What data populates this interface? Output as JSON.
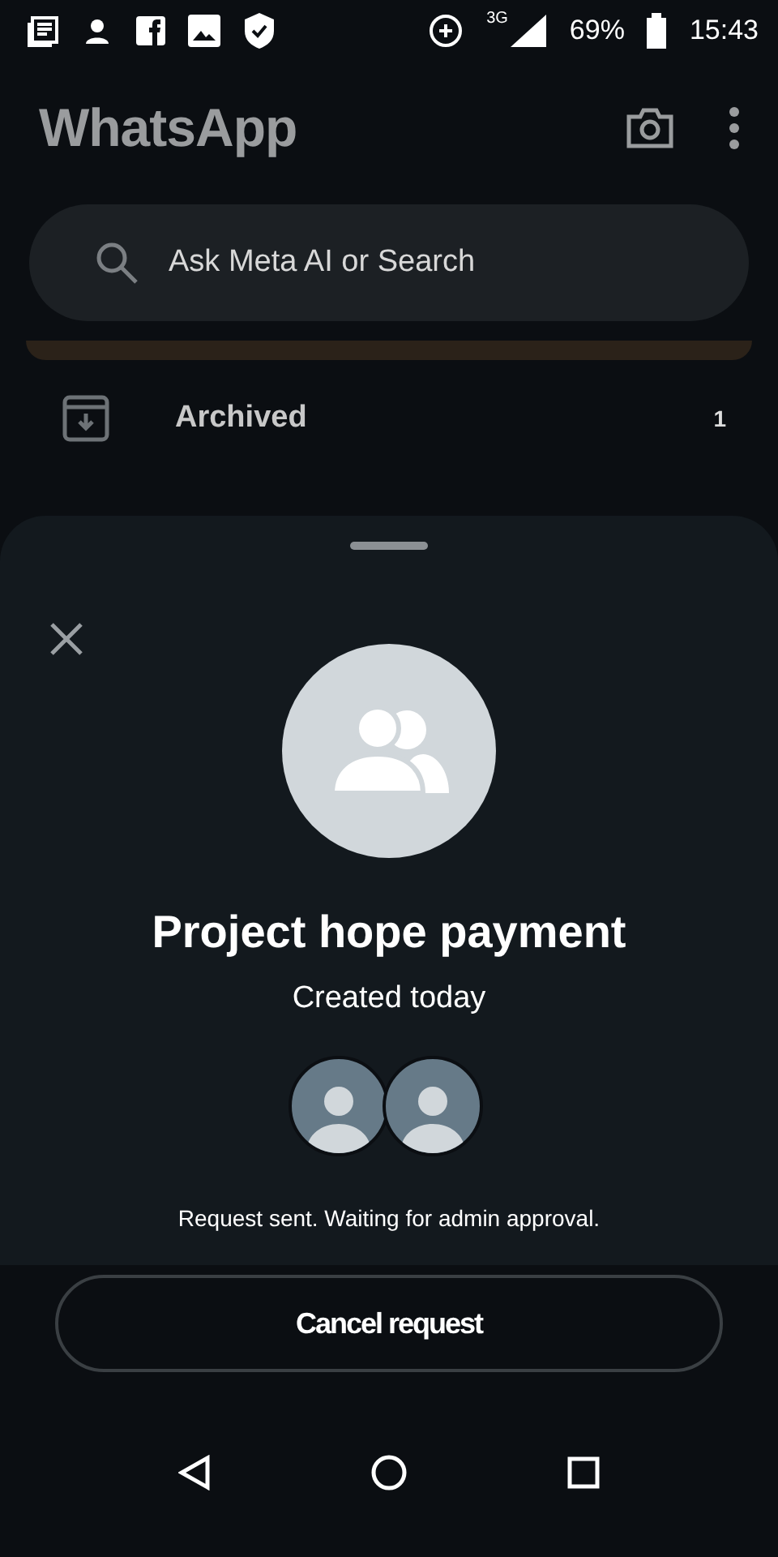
{
  "status_bar": {
    "battery": "69%",
    "time": "15:43",
    "network": "3G"
  },
  "app_bar": {
    "title": "WhatsApp"
  },
  "search": {
    "placeholder": "Ask Meta AI or Search"
  },
  "archived": {
    "label": "Archived",
    "count": "1"
  },
  "sheet": {
    "title": "Project hope payment",
    "subtitle": "Created today",
    "members": [
      {
        "kind": "avatar"
      },
      {
        "kind": "avatar"
      }
    ],
    "message": "Request sent. Waiting for admin approval."
  },
  "action": {
    "label": "Cancel request"
  }
}
